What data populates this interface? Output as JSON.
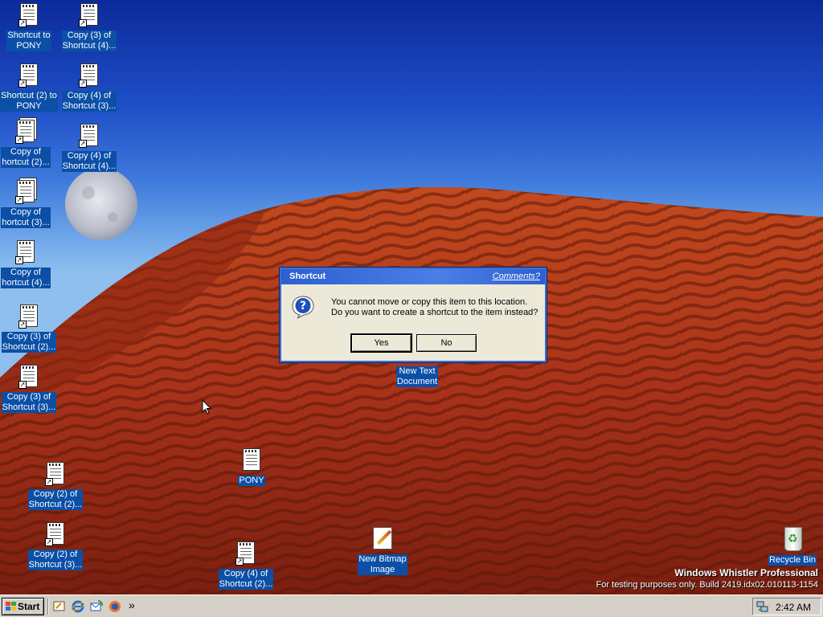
{
  "desktop": {
    "icons": [
      {
        "label": "Shortcut to\nPONY",
        "type": "notepad-shortcut-icon"
      },
      {
        "label": "Copy (3) of\nShortcut (4)...",
        "type": "notepad-shortcut-icon"
      },
      {
        "label": "Shortcut (2) to\nPONY",
        "type": "notepad-shortcut-icon"
      },
      {
        "label": "Copy (4) of\nShortcut (3)...",
        "type": "notepad-shortcut-icon"
      },
      {
        "label": "Copy of\nhortcut (2)...",
        "type": "stacked-shortcut-icon"
      },
      {
        "label": "Copy (4) of\nShortcut (4)...",
        "type": "notepad-shortcut-icon"
      },
      {
        "label": "Copy of\nhortcut (3)...",
        "type": "stacked-shortcut-icon"
      },
      {
        "label": "Copy of\nhortcut (4)...",
        "type": "notepad-shortcut-icon"
      },
      {
        "label": "Copy (3) of\nShortcut (2)...",
        "type": "notepad-shortcut-icon"
      },
      {
        "label": "Copy (3) of\nShortcut (3)...",
        "type": "notepad-shortcut-icon"
      },
      {
        "label": "Copy (2) of\nShortcut (2)...",
        "type": "notepad-shortcut-icon"
      },
      {
        "label": "Copy (2) of\nShortcut (3)...",
        "type": "notepad-shortcut-icon"
      },
      {
        "label": "PONY",
        "type": "notepad-icon"
      },
      {
        "label": "Copy (4) of\nShortcut (2)...",
        "type": "notepad-shortcut-icon"
      },
      {
        "label": "New Text\nDocument",
        "type": "text-document-icon"
      },
      {
        "label": "New Bitmap\nImage",
        "type": "bitmap-icon"
      },
      {
        "label": "Recycle Bin",
        "type": "recycle-bin-icon"
      }
    ]
  },
  "dialog": {
    "title": "Shortcut",
    "comments_link": "Comments?",
    "message_line1": "You cannot move or copy this item to this location.",
    "message_line2": "Do you want to create a shortcut to the item instead?",
    "yes_label": "Yes",
    "no_label": "No",
    "icon": "question-icon"
  },
  "watermark": {
    "title": "Windows Whistler Professional",
    "build": "For testing purposes only. Build 2419.idx02.010113-1154"
  },
  "taskbar": {
    "start_label": "Start",
    "quick_launch": [
      "show-desktop-icon",
      "internet-explorer-icon",
      "outlook-express-icon",
      "media-player-icon"
    ],
    "chevron": "»",
    "clock": "2:42 AM",
    "tray_icon": "network-icon"
  },
  "colors": {
    "icon_label_bg": "#0b4fa6",
    "dialog_title": "#2c5fd0",
    "taskbar": "#d4d0c8"
  }
}
